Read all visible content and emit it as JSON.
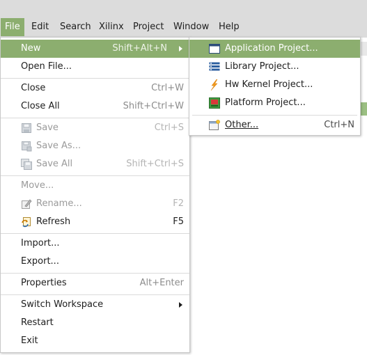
{
  "menubar": {
    "items": [
      "File",
      "Edit",
      "Search",
      "Xilinx",
      "Project",
      "Window",
      "Help"
    ]
  },
  "file_menu": {
    "new": {
      "label": "New",
      "shortcut": "Shift+Alt+N"
    },
    "open_file": {
      "label": "Open File..."
    },
    "close": {
      "label": "Close",
      "shortcut": "Ctrl+W"
    },
    "close_all": {
      "label": "Close All",
      "shortcut": "Shift+Ctrl+W"
    },
    "save": {
      "label": "Save",
      "shortcut": "Ctrl+S",
      "icon": "save-icon"
    },
    "save_as": {
      "label": "Save As...",
      "icon": "save-as-icon"
    },
    "save_all": {
      "label": "Save All",
      "shortcut": "Shift+Ctrl+S",
      "icon": "save-all-icon"
    },
    "move": {
      "label": "Move..."
    },
    "rename": {
      "label": "Rename...",
      "shortcut": "F2",
      "icon": "rename-icon"
    },
    "refresh": {
      "label": "Refresh",
      "shortcut": "F5",
      "icon": "refresh-icon"
    },
    "import": {
      "label": "Import..."
    },
    "export": {
      "label": "Export..."
    },
    "properties": {
      "label": "Properties",
      "shortcut": "Alt+Enter"
    },
    "switch_workspace": {
      "label": "Switch Workspace"
    },
    "restart": {
      "label": "Restart"
    },
    "exit": {
      "label": "Exit"
    }
  },
  "new_submenu": {
    "application_project": {
      "label": "Application Project...",
      "icon": "application-project-icon"
    },
    "library_project": {
      "label": "Library Project...",
      "icon": "library-project-icon"
    },
    "hw_kernel_project": {
      "label": "Hw Kernel Project...",
      "icon": "hw-kernel-icon"
    },
    "platform_project": {
      "label": "Platform Project...",
      "icon": "platform-project-icon"
    },
    "other": {
      "label": "Other...",
      "shortcut": "Ctrl+N",
      "icon": "other-wizard-icon"
    }
  },
  "colors": {
    "highlight": "#8cae6f",
    "menubar_bg": "#dcdcdc"
  }
}
